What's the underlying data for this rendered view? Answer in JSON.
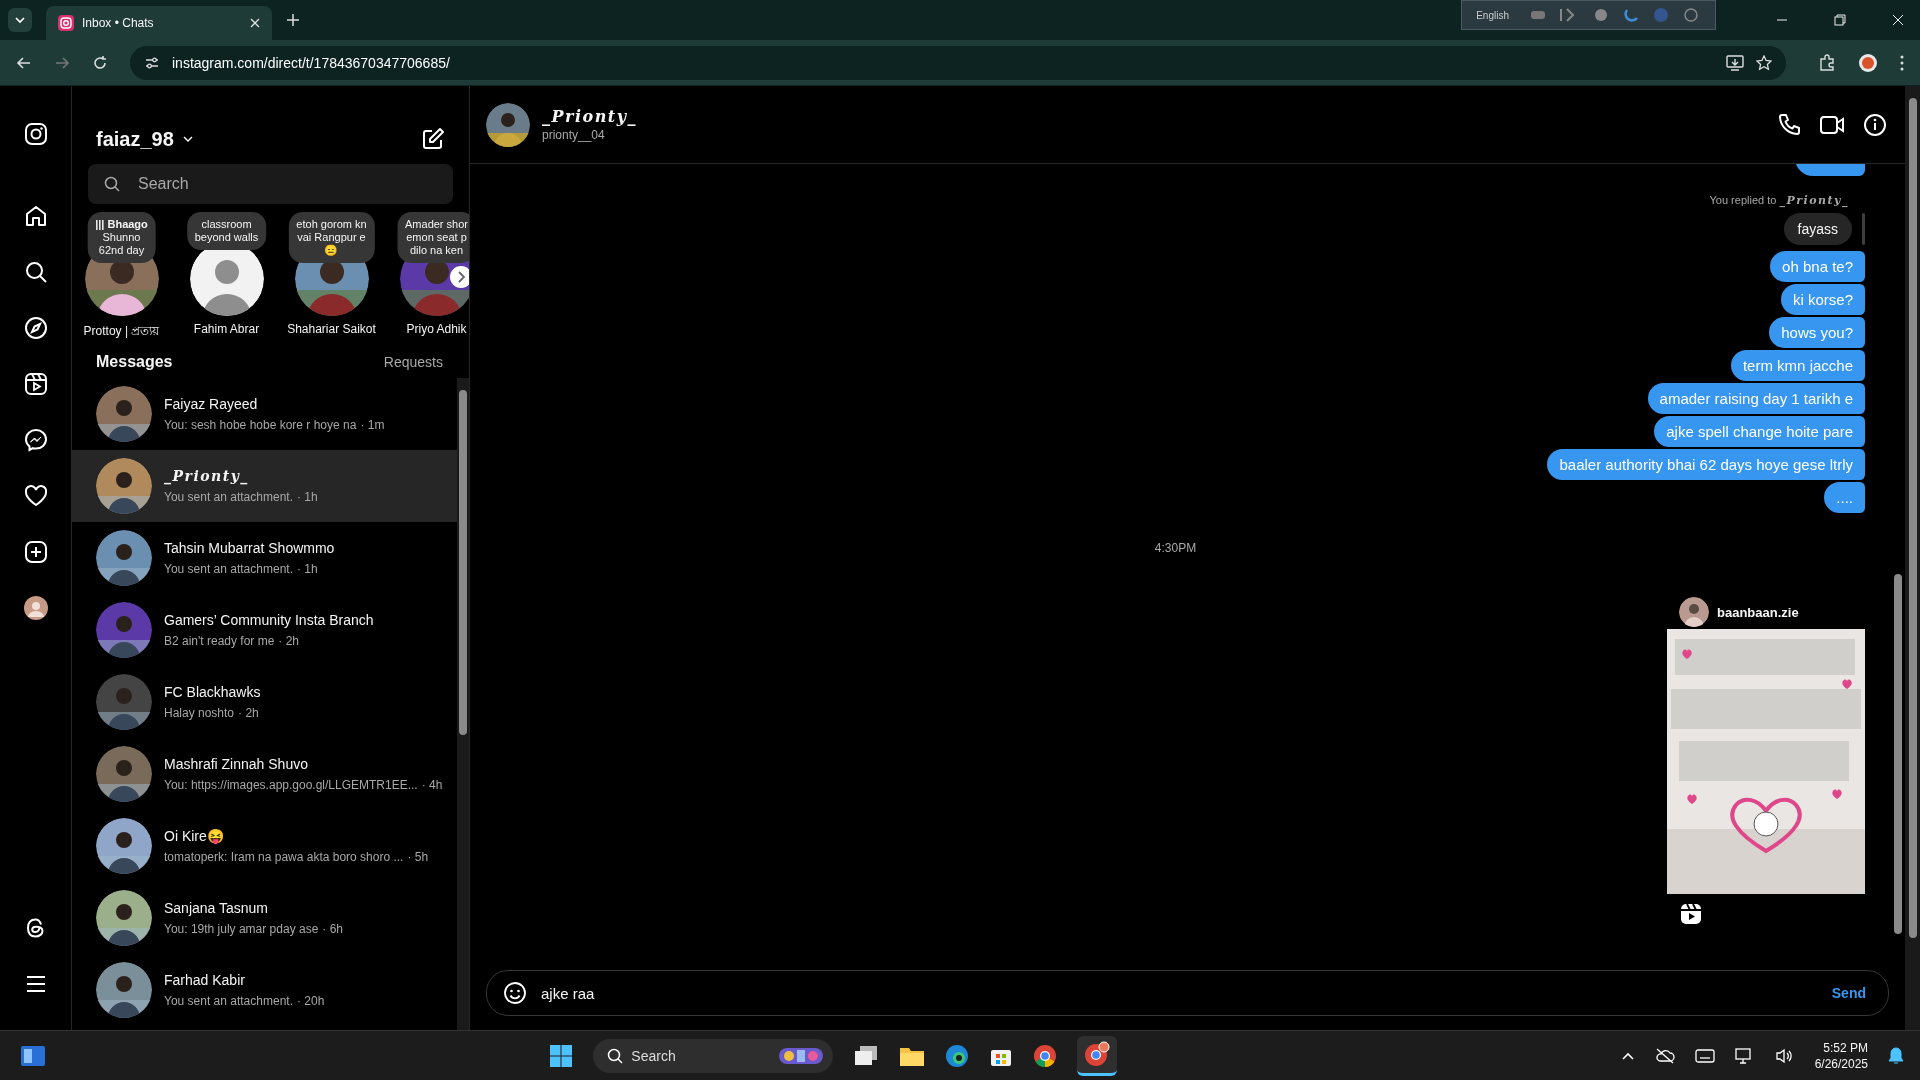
{
  "browser": {
    "tab_title": "Inbox • Chats",
    "url": "instagram.com/direct/t/17843670347706685/",
    "language_bar": "English"
  },
  "inbox": {
    "username": "faiaz_98",
    "search": {
      "placeholder": "Search"
    },
    "notes": [
      {
        "lines": [
          "**||| Bhaago**",
          "Shunno",
          "62nd day"
        ],
        "name": "Prottoy | প্রত্যয়"
      },
      {
        "lines": [
          "classroom",
          "beyond walls"
        ],
        "name": "Fahim Abrar"
      },
      {
        "lines": [
          "etoh gorom kn",
          "vai Rangpur e",
          "😑"
        ],
        "name": "Shahariar Saikot"
      },
      {
        "lines": [
          "Amader shor",
          "emon seat p",
          "dilo na ken"
        ],
        "name": "Priyo Adhik"
      }
    ],
    "messages_heading": "Messages",
    "requests_label": "Requests",
    "conversations": [
      {
        "name": "Faiyaz Rayeed",
        "preview": "You: sesh hobe hobe kore r hoye na",
        "time": "· 1m",
        "selected": false,
        "fancy": false
      },
      {
        "name": "_Prionty_",
        "preview": "You sent an attachment.",
        "time": "· 1h",
        "selected": true,
        "fancy": true
      },
      {
        "name": "Tahsin Mubarrat Showmmo",
        "preview": "You sent an attachment.",
        "time": "· 1h",
        "selected": false,
        "fancy": false
      },
      {
        "name": "Gamers’ Community Insta Branch",
        "preview": "B2 ain't ready for me",
        "time": "· 2h",
        "selected": false,
        "fancy": false
      },
      {
        "name": "FC Blackhawks",
        "preview": "Halay noshto",
        "time": "· 2h",
        "selected": false,
        "fancy": false
      },
      {
        "name": "Mashrafi Zinnah Shuvo",
        "preview": "You: https://images.app.goo.gl/LLGEMTR1EE...",
        "time": "· 4h",
        "selected": false,
        "fancy": false
      },
      {
        "name": "Oi Kire😝",
        "preview": "tomatoperk: Iram na pawa akta boro shoro ...",
        "time": "· 5h",
        "selected": false,
        "fancy": false
      },
      {
        "name": "Sanjana Tasnum",
        "preview": "You: 19th july amar pday ase",
        "time": "· 6h",
        "selected": false,
        "fancy": false
      },
      {
        "name": "Farhad Kabir",
        "preview": "You sent an attachment.",
        "time": "· 20h",
        "selected": false,
        "fancy": false
      }
    ]
  },
  "chat": {
    "name": "_Prionty_",
    "handle": "prionty__04",
    "messages": [
      {
        "kind": "cut"
      },
      {
        "kind": "reply_label",
        "text": "You replied to",
        "target": "_Prionty_"
      },
      {
        "kind": "quoted",
        "text": "fayass"
      },
      {
        "kind": "sent",
        "text": "oh bna te?"
      },
      {
        "kind": "sent",
        "text": "ki korse?"
      },
      {
        "kind": "sent",
        "text": "hows you?"
      },
      {
        "kind": "sent",
        "text": "term kmn jacche"
      },
      {
        "kind": "sent",
        "text": "amader raising day 1 tarikh e"
      },
      {
        "kind": "sent",
        "text": "ajke spell change hoite pare"
      },
      {
        "kind": "sent",
        "text": "baaler authority bhai 62 days hoye gese ltrly"
      },
      {
        "kind": "sent",
        "text": "...."
      },
      {
        "kind": "time",
        "text": "4:30PM"
      },
      {
        "kind": "post",
        "username": "baanbaan.zie"
      }
    ],
    "composer": {
      "value": "ajke raa",
      "send": "Send"
    }
  },
  "taskbar": {
    "search": {
      "placeholder": "Search"
    },
    "time": "5:52 PM",
    "date": "6/26/2025"
  }
}
